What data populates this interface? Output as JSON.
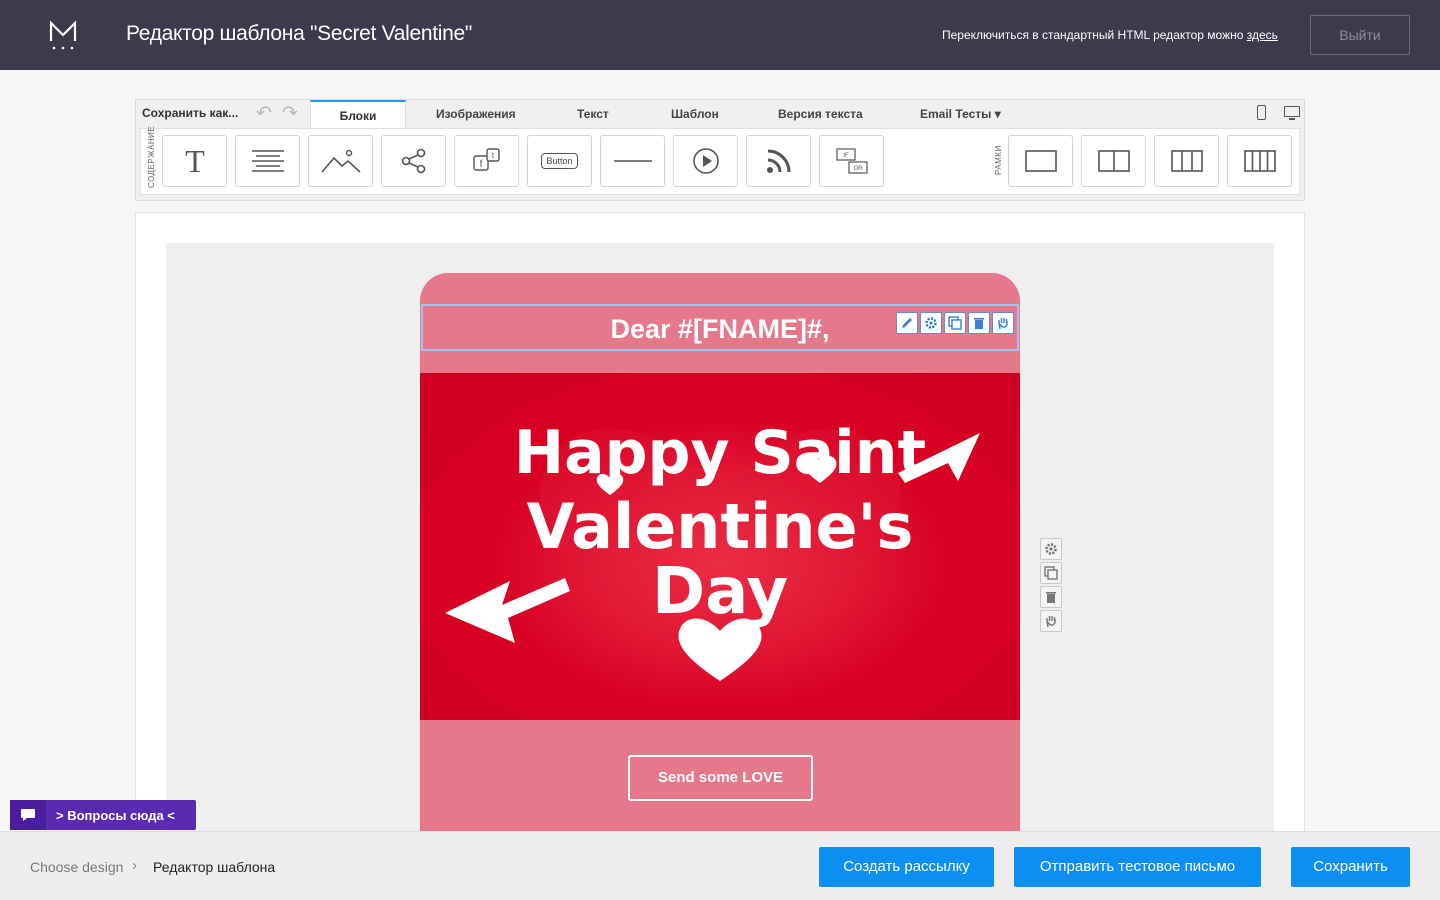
{
  "header": {
    "title": "Редактор шаблона \"Secret Valentine\"",
    "switch_text": "Переключиться в стандартный HTML редактор можно ",
    "switch_link": "здесь",
    "exit_label": "Выйти"
  },
  "toolbar": {
    "save_as": "Сохранить как...",
    "tabs": [
      "Блоки",
      "Изображения",
      "Текст",
      "Шаблон",
      "Версия текста",
      "Email Тесты ▾"
    ],
    "content_label": "СОДЕРЖАНИЕ",
    "frames_label": "РАМКИ",
    "button_tool_label": "Button",
    "if_label": "IF",
    "or_label": "OR"
  },
  "email": {
    "greeting": "Dear #[FNAME]#,",
    "hero_lines": [
      "Happy Saint",
      "Valentine's",
      "Day"
    ],
    "cta": "Send some LOVE"
  },
  "chat": {
    "label": "> Вопросы сюда <"
  },
  "footer": {
    "crumb1": "Choose design",
    "crumb_sep": "›",
    "crumb2": "Редактор шаблона",
    "btn_create": "Создать рассылку",
    "btn_test": "Отправить тестовое письмо",
    "btn_save": "Сохранить"
  },
  "colors": {
    "header_bg": "#3c3a4d",
    "email_pink": "#e5788a",
    "hero_red": "#d80023",
    "primary_blue": "#0d8ef2",
    "chat_purple": "#5a2bb0"
  }
}
